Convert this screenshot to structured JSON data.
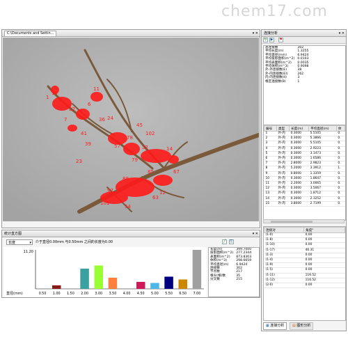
{
  "watermark": "chem17.com",
  "image_window": {
    "title": "C:\\Documents and Settin...",
    "controls": "▾ ✕"
  },
  "analysis_panel": {
    "title": "连接分析",
    "controls": "▾ ✕",
    "summary": [
      {
        "label": "总连接数",
        "value": "302"
      },
      {
        "label": "平均长度(m)",
        "value": "1.3255"
      },
      {
        "label": "平均直径(mm)",
        "value": "6.9424"
      },
      {
        "label": "平均投影面积(m^2)",
        "value": "0.0103"
      },
      {
        "label": "平均表面积(m^2)",
        "value": "0.0035"
      },
      {
        "label": "平均体积(m^3)",
        "value": "0.9098"
      },
      {
        "label": "外-外连接数(E)",
        "value": "38"
      },
      {
        "label": "外-内连接数(EI)",
        "value": "262"
      },
      {
        "label": "内-内连接数(II)",
        "value": "3"
      },
      {
        "label": "根区连接数(B)",
        "value": "1"
      }
    ],
    "table_headers": [
      "编号",
      "类型",
      "长度(m)",
      "平均直径(m)",
      "体"
    ],
    "table_rows": [
      [
        "1",
        "外-内",
        "0.3000",
        "5.5105",
        "0."
      ],
      [
        "2",
        "外-内",
        "0.3000",
        "5.3866",
        "0."
      ],
      [
        "3",
        "外-内",
        "0.3000",
        "5.5105",
        "0."
      ],
      [
        "4",
        "外-内",
        "0.3000",
        "2.9223",
        "0."
      ],
      [
        "5",
        "外-内",
        "0.3000",
        "3.1473",
        "0."
      ],
      [
        "6",
        "外-内",
        "0.3000",
        "1.6586",
        "0."
      ],
      [
        "7",
        "外-内",
        "2.8000",
        "2.9823",
        "0."
      ],
      [
        "8",
        "外-内",
        "5.2000",
        "3.3912",
        "1."
      ],
      [
        "9",
        "外-内",
        "0.8000",
        "1.3359",
        "0."
      ],
      [
        "10",
        "外-内",
        "0.3000",
        "1.8647",
        "0."
      ],
      [
        "11",
        "外-内",
        "2.2000",
        "3.0065",
        "0."
      ],
      [
        "12",
        "外-内",
        "0.3000",
        "3.5067",
        "0."
      ],
      [
        "13",
        "外-内",
        "0.3000",
        "1.8712",
        "0."
      ],
      [
        "14",
        "外-内",
        "0.3000",
        "2.3252",
        "0."
      ],
      [
        "15",
        "外-内",
        "3.8000",
        "2.7199",
        "0."
      ]
    ],
    "pair_headers": [
      "连接对",
      "角度°"
    ],
    "pair_rows": [
      [
        "(1-0)",
        "0.00"
      ],
      [
        "(1-8)",
        "0.00"
      ],
      [
        "(1-10)",
        "0.00"
      ],
      [
        "(1-17)",
        "46.31"
      ],
      [
        "(1-3)",
        "0.00"
      ],
      [
        "(1-4)",
        "0.00"
      ],
      [
        "(1-9)",
        "0.00"
      ],
      [
        "(1-5)",
        "0.00"
      ],
      [
        "(1-11)",
        "116.52"
      ],
      [
        "(1-12)",
        "116.52"
      ],
      [
        "(2-0)",
        "0.00"
      ]
    ],
    "bottom_tabs": [
      "连接分析",
      "图形分析"
    ]
  },
  "histogram_panel": {
    "title": "统计直方图",
    "controls": "▾ ✕",
    "dropdown_value": "长度",
    "caption": "介于直径0.00mm 与0.50mm 之间的长度为0.00",
    "y_max_label": "11.20",
    "x_axis_label": "直径(mm)",
    "stats": [
      {
        "label": "长度(m)",
        "value": "399.7000"
      },
      {
        "label": "投影面积(m^2)",
        "value": "277.2344"
      },
      {
        "label": "表面积(m^2)",
        "value": "873.8303"
      },
      {
        "label": "体积(m^3)",
        "value": "298.6659"
      },
      {
        "label": "平均直径(m)",
        "value": "6.9424"
      },
      {
        "label": "连接数",
        "value": "302"
      },
      {
        "label": "节点数",
        "value": "217"
      },
      {
        "label": "根尖(根)数",
        "value": "35"
      },
      {
        "label": "分叉数",
        "value": "215"
      }
    ]
  },
  "colors": {
    "bars": [
      "#ffffff",
      "#8b1a1a",
      "#ff9999",
      "#3aa0a0",
      "#99ff33",
      "#ff7f3f",
      "#ffffff",
      "#cc1a5a",
      "#4db8e8",
      "#000080",
      "#cc8800",
      "#a0a0a0"
    ]
  },
  "chart_data": {
    "type": "bar",
    "categories": [
      "0.50",
      "1.00",
      "1.50",
      "2.00",
      "3.00",
      "3.50",
      "4.00",
      "4.50",
      "5.00",
      "5.50",
      "6.50",
      "7.00"
    ],
    "values": [
      0.0,
      1.0,
      0.0,
      5.8,
      6.7,
      3.2,
      0.0,
      2.0,
      1.7,
      3.5,
      2.7,
      11.2
    ],
    "xlabel": "直径(mm)",
    "ylim": [
      0,
      11.2
    ]
  }
}
